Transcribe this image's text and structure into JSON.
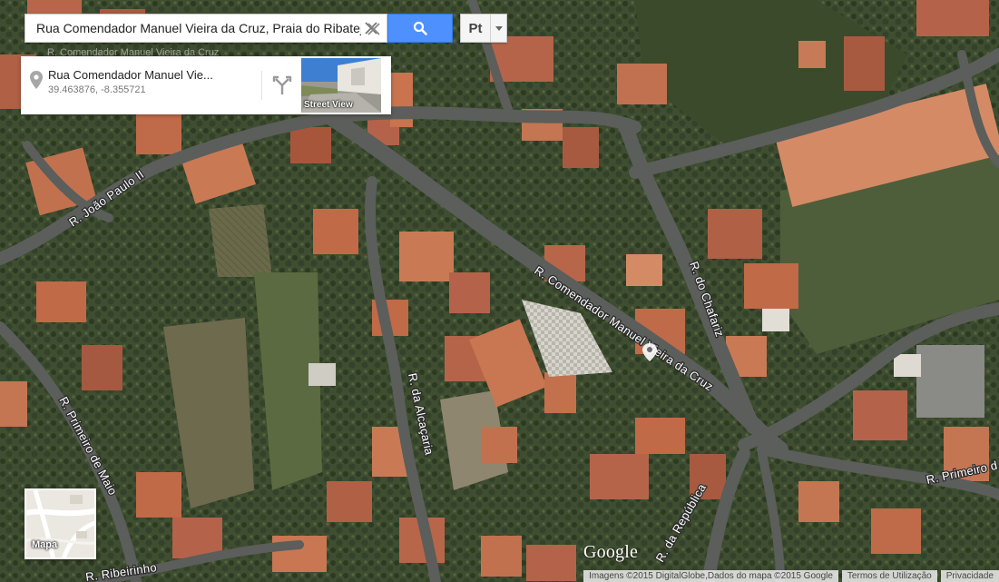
{
  "search": {
    "value": "Rua Comendador Manuel Vieira da Cruz, Praia do Ribatejo",
    "language_label": "Pt"
  },
  "ghost_text": "R. Comendador Manuel Vieira da Cruz",
  "place_card": {
    "title": "Rua Comendador Manuel Vie...",
    "coords": "39.463876, -8.355721",
    "street_view_label": "Street View"
  },
  "map_toggle": {
    "label": "Mapa"
  },
  "logo": "Google",
  "footer": {
    "imagery": "Imagens ©2015 DigitalGlobe,Dados do mapa ©2015 Google",
    "terms": "Termos de Utilização",
    "privacy": "Privacidade"
  },
  "roads": {
    "joao_paulo": "R. João Paulo II",
    "chafariz": "R. do Chafariz",
    "comendador": "R. Comendador Manuel Vieira da Cruz",
    "alcacaria": "R. da Alcaçaria",
    "primeiro_maio": "R. Primeiro de Maio",
    "primeiro_right": "R. Primeiro d",
    "republica": "R. da República",
    "ribeirinho": "R. Ribeirinho"
  },
  "colors": {
    "vegetation": "#3b4a2c",
    "roof": "#b8664a",
    "road": "#5b5e5a",
    "search_blue": "#4d90fe"
  },
  "icons": {
    "clear": "close-icon",
    "search": "search-icon",
    "caret": "caret-down-icon",
    "pin": "map-pin-icon",
    "directions": "directions-icon",
    "close": "close-icon",
    "marker": "location-marker-icon"
  }
}
